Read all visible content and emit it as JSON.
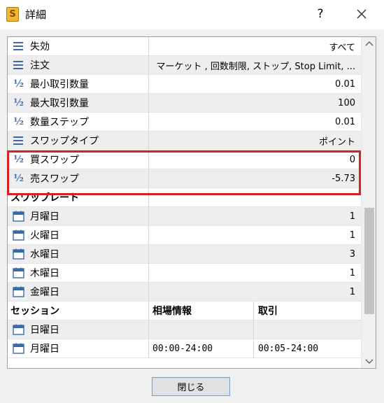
{
  "window": {
    "title": "詳細",
    "help_label": "?",
    "icon_letter": "S"
  },
  "rows": [
    {
      "icon": "list-icon",
      "label": "失効",
      "value": "すべて"
    },
    {
      "icon": "list-icon",
      "label": "注文",
      "value": "マーケット , 回数制限, ストップ, Stop Limit, ..."
    },
    {
      "icon": "half-icon",
      "label": "最小取引数量",
      "value": "0.01"
    },
    {
      "icon": "half-icon",
      "label": "最大取引数量",
      "value": "100"
    },
    {
      "icon": "half-icon",
      "label": "数量ステップ",
      "value": "0.01"
    },
    {
      "icon": "list-icon",
      "label": "スワップタイプ",
      "value": "ポイント"
    },
    {
      "icon": "half-icon",
      "label": "買スワップ",
      "value": "0"
    },
    {
      "icon": "half-icon",
      "label": "売スワップ",
      "value": "-5.73"
    }
  ],
  "swap_rate": {
    "heading": "スワップレート",
    "days": [
      {
        "label": "月曜日",
        "value": "1"
      },
      {
        "label": "火曜日",
        "value": "1"
      },
      {
        "label": "水曜日",
        "value": "3"
      },
      {
        "label": "木曜日",
        "value": "1"
      },
      {
        "label": "金曜日",
        "value": "1"
      }
    ]
  },
  "session": {
    "heading": "セッション",
    "col_quotes": "相場情報",
    "col_trade": "取引",
    "rows": [
      {
        "label": "日曜日",
        "quotes": "",
        "trade": ""
      },
      {
        "label": "月曜日",
        "quotes": "00:00-24:00",
        "trade": "00:05-24:00"
      }
    ]
  },
  "footer": {
    "close_label": "閉じる"
  },
  "colors": {
    "highlight": "#d32323",
    "icon_blue": "#3a6aa6"
  }
}
